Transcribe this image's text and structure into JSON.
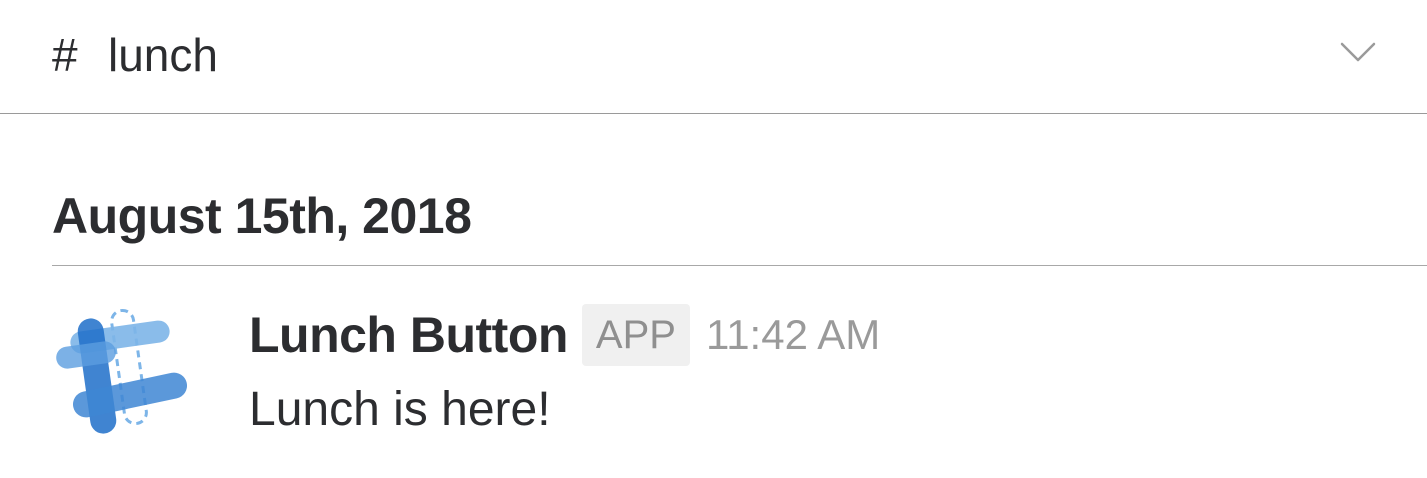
{
  "channel": {
    "prefix": "#",
    "name": "lunch",
    "menu_icon": "chevron-down-icon"
  },
  "date_divider": {
    "label": "August 15th, 2018"
  },
  "message": {
    "avatar_icon": "lunch-button-app-logo",
    "sender": "Lunch Button",
    "badge": "APP",
    "time": "11:42 AM",
    "text": "Lunch is here!"
  },
  "colors": {
    "avatar_blue_dark": "#1f6fc9",
    "avatar_blue_light": "#7db5e8"
  }
}
